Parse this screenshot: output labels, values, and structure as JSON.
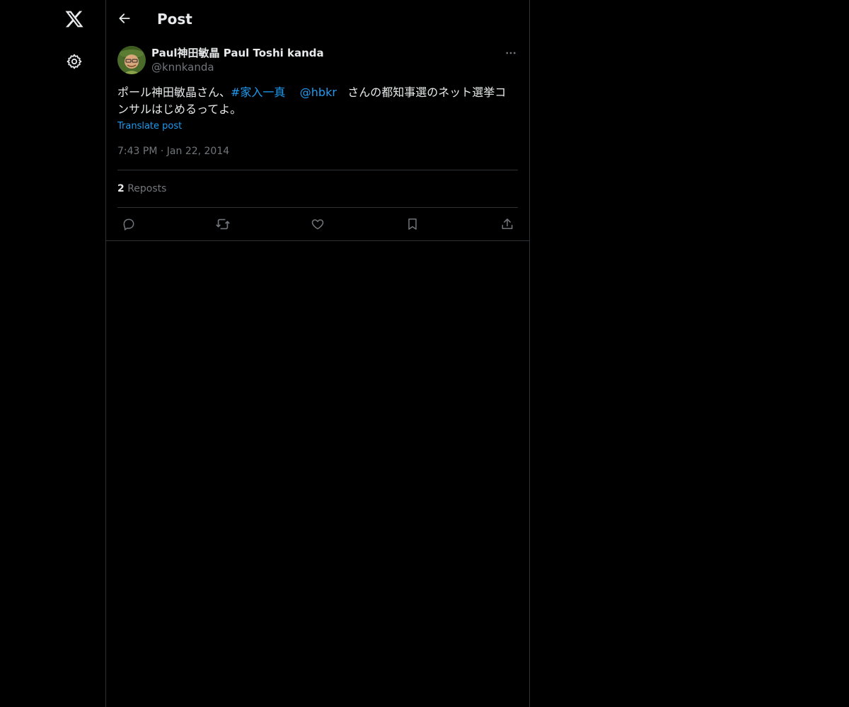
{
  "nav": {
    "logo_icon": "x-logo-icon",
    "settings_icon": "gear-icon"
  },
  "header": {
    "title": "Post",
    "back_icon": "arrow-left-icon"
  },
  "post": {
    "author_name": "Paul神田敏晶 Paul Toshi kanda",
    "author_handle": "@knnkanda",
    "text_before": "ポール神田敏晶さん、",
    "hashtag": "#家入一真",
    "mention": "@hbkr",
    "text_after": "さんの都知事選のネット選挙コンサルはじめるってよ。",
    "translate_label": "Translate post",
    "time": "7:43 PM",
    "separator": "·",
    "date": "Jan 22, 2014",
    "reposts_count": "2",
    "reposts_label": "Reposts"
  },
  "actions": {
    "reply_icon": "reply-icon",
    "repost_icon": "repost-icon",
    "like_icon": "heart-icon",
    "bookmark_icon": "bookmark-icon",
    "share_icon": "share-icon"
  },
  "colors": {
    "background": "#000000",
    "text_primary": "#e7e9ea",
    "text_secondary": "#71767b",
    "accent": "#1d9bf0",
    "border": "#2f3336"
  }
}
